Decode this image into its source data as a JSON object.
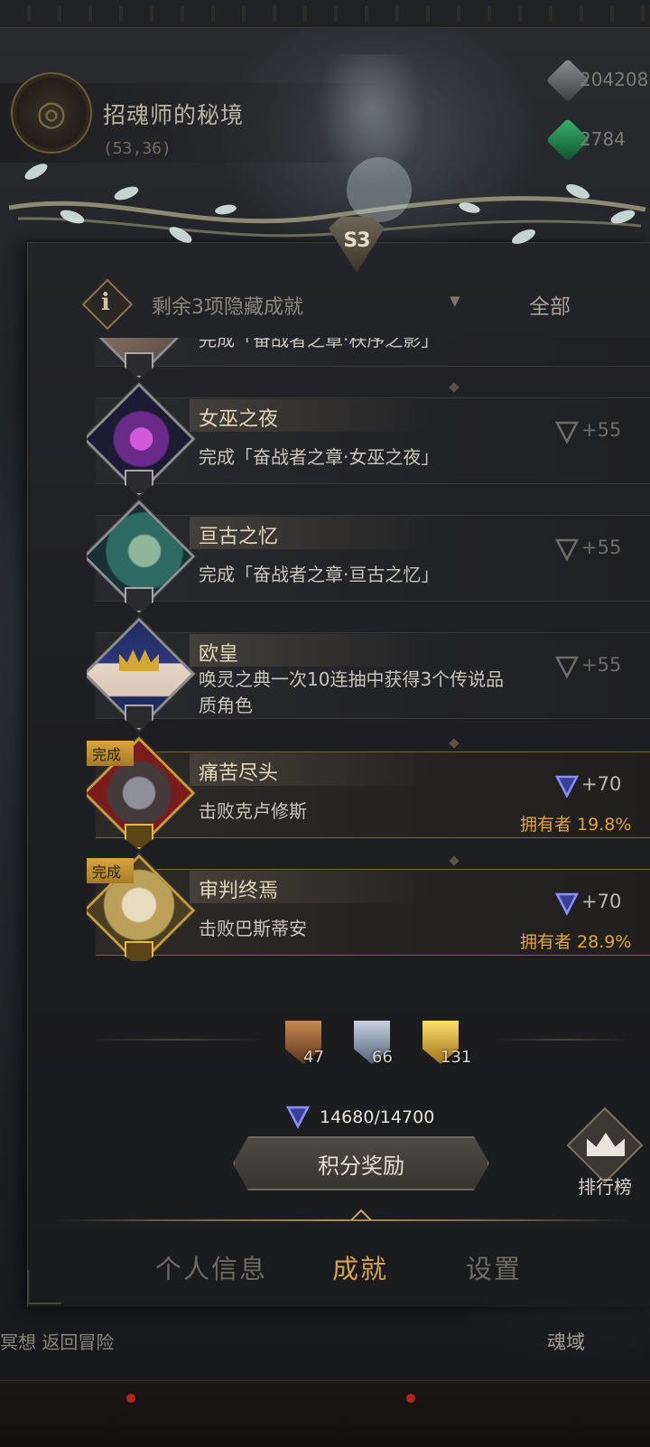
{
  "location": {
    "title": "招魂师的秘境",
    "coords": "(53,36)"
  },
  "resources": [
    {
      "name": "stone",
      "value": "204208"
    },
    {
      "name": "emerald",
      "value": "2784"
    }
  ],
  "season": {
    "badge": "S3"
  },
  "filter": {
    "label": "剩余3项隐藏成就",
    "scope": "全部"
  },
  "achievements": [
    {
      "name": "",
      "desc": "完成「奋战者之章·秩序之影」",
      "points": "",
      "owner": "",
      "done": false
    },
    {
      "name": "女巫之夜",
      "desc": "完成「奋战者之章·女巫之夜」",
      "points": "+55",
      "owner": "",
      "done": false
    },
    {
      "name": "亘古之忆",
      "desc": "完成「奋战者之章·亘古之忆」",
      "points": "+55",
      "owner": "",
      "done": false
    },
    {
      "name": "欧皇",
      "desc": "唤灵之典一次10连抽中获得3个传说品质角色",
      "points": "+55",
      "owner": "",
      "done": false
    },
    {
      "name": "痛苦尽头",
      "desc": "击败克卢修斯",
      "points": "+70",
      "owner": "拥有者 19.8%",
      "done": true
    },
    {
      "name": "审判终焉",
      "desc": "击败巴斯蒂安",
      "points": "+70",
      "owner": "拥有者 28.9%",
      "done": true
    }
  ],
  "done_tag": "完成",
  "badges": {
    "bronze": "47",
    "silver": "66",
    "gold": "131"
  },
  "score": "14680/14700",
  "reward_button": "积分奖励",
  "leaderboard": "排行榜",
  "tabs": {
    "profile": "个人信息",
    "achievements": "成就",
    "settings": "设置"
  },
  "bottom": {
    "left": "冥想 返回冒险",
    "right": "魂域"
  },
  "colors": {
    "accent": "#d7a24a",
    "owner": "#e0a53a",
    "done_tag": "#d7a641"
  }
}
